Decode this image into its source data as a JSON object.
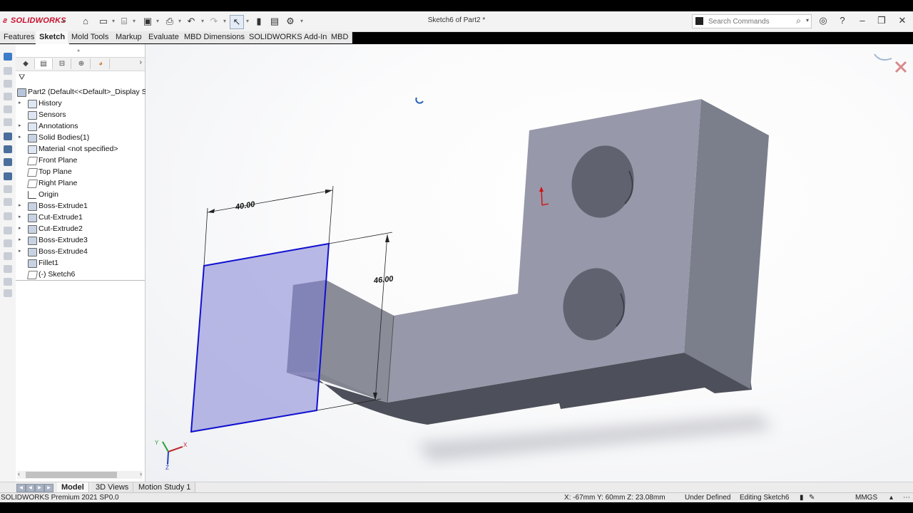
{
  "app": {
    "brand": "SOLIDWORKS",
    "document_title": "Sketch6 of Part2 *"
  },
  "search": {
    "placeholder": "Search Commands"
  },
  "command_tabs": [
    {
      "label": "Features"
    },
    {
      "label": "Sketch",
      "active": true
    },
    {
      "label": "Mold Tools"
    },
    {
      "label": "Markup"
    },
    {
      "label": "Evaluate"
    },
    {
      "label": "MBD Dimensions"
    },
    {
      "label": "SOLIDWORKS Add-Ins"
    },
    {
      "label": "MBD"
    }
  ],
  "feature_tree": {
    "root": "Part2  (Default<<Default>_Display S",
    "items": [
      {
        "label": "History",
        "expandable": true,
        "icon": "history-icon"
      },
      {
        "label": "Sensors",
        "expandable": false,
        "icon": "sensors-icon"
      },
      {
        "label": "Annotations",
        "expandable": true,
        "icon": "annotations-icon"
      },
      {
        "label": "Solid Bodies(1)",
        "expandable": true,
        "icon": "solid-bodies-icon"
      },
      {
        "label": "Material <not specified>",
        "expandable": false,
        "icon": "material-icon"
      },
      {
        "label": "Front Plane",
        "expandable": false,
        "icon": "plane-icon"
      },
      {
        "label": "Top Plane",
        "expandable": false,
        "icon": "plane-icon"
      },
      {
        "label": "Right Plane",
        "expandable": false,
        "icon": "plane-icon"
      },
      {
        "label": "Origin",
        "expandable": false,
        "icon": "origin-icon"
      },
      {
        "label": "Boss-Extrude1",
        "expandable": true,
        "icon": "boss-extrude-icon"
      },
      {
        "label": "Cut-Extrude1",
        "expandable": true,
        "icon": "cut-extrude-icon"
      },
      {
        "label": "Cut-Extrude2",
        "expandable": true,
        "icon": "cut-extrude-icon"
      },
      {
        "label": "Boss-Extrude3",
        "expandable": true,
        "icon": "boss-extrude-icon"
      },
      {
        "label": "Boss-Extrude4",
        "expandable": true,
        "icon": "boss-extrude-icon"
      },
      {
        "label": "Fillet1",
        "expandable": false,
        "icon": "fillet-icon"
      },
      {
        "label": "(-) Sketch6",
        "expandable": false,
        "icon": "sketch-icon"
      }
    ]
  },
  "sketch": {
    "dim_width": "40.00",
    "dim_height": "46.00",
    "sketch_fill": "#8f8fd8",
    "sketch_line": "#1010d0"
  },
  "triad": {
    "x": "X",
    "y": "Y",
    "z": "Z"
  },
  "bottom_tabs": [
    {
      "label": "Model",
      "active": true
    },
    {
      "label": "3D Views"
    },
    {
      "label": "Motion Study 1"
    }
  ],
  "status": {
    "product": "SOLIDWORKS Premium 2021 SP0.0",
    "coords": "X: -67mm Y: 60mm Z: 23.08mm",
    "sketch_state": "Under Defined",
    "editing": "Editing Sketch6",
    "units": "MMGS"
  }
}
